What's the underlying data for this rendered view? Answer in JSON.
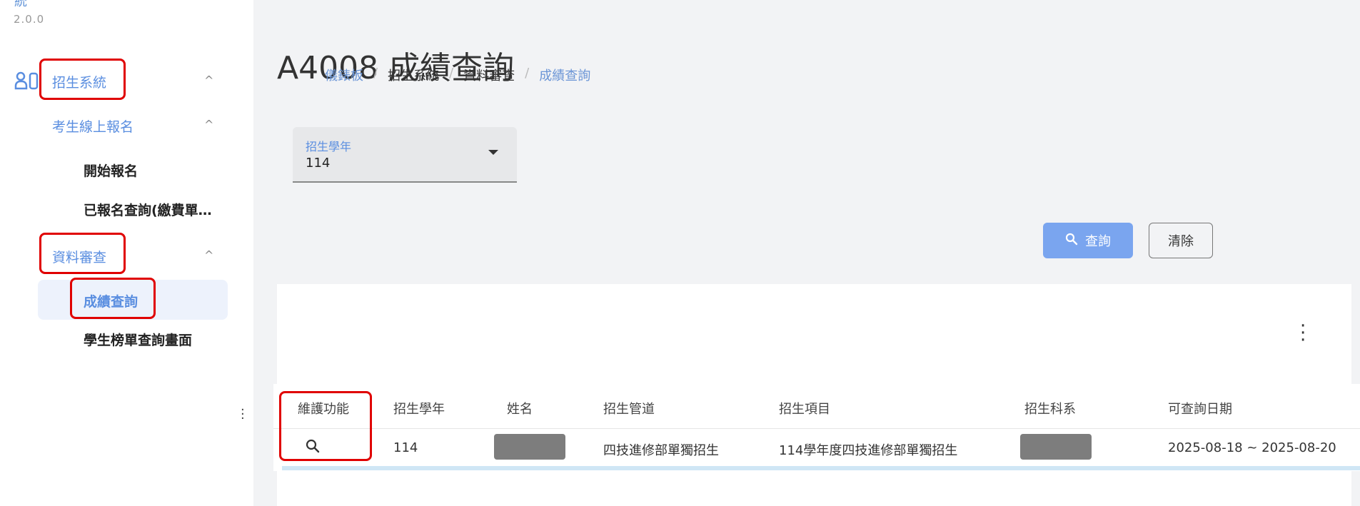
{
  "sidebar": {
    "title_fragment": "統",
    "version": "2.0.0",
    "items": [
      {
        "label": "招生系統",
        "level": 1,
        "expanded": true
      },
      {
        "label": "考生線上報名",
        "level": 2,
        "expanded": true
      },
      {
        "label": "開始報名",
        "level": 3
      },
      {
        "label": "已報名查詢(繳費單…",
        "level": 3
      },
      {
        "label": "資料審查",
        "level": 2,
        "expanded": true
      },
      {
        "label": "成績查詢",
        "level": 3,
        "selected": true
      },
      {
        "label": "學生榜單查詢畫面",
        "level": 3
      }
    ],
    "chevron": "^"
  },
  "page": {
    "title": "A4008 成績查詢",
    "breadcrumb": [
      "儀錶板",
      "招生系統",
      "資料審查",
      "成績查詢"
    ]
  },
  "filters": {
    "year": {
      "label": "招生學年",
      "value": "114"
    }
  },
  "buttons": {
    "query": "查詢",
    "clear": "清除"
  },
  "table": {
    "columns": [
      "維護功能",
      "招生學年",
      "姓名",
      "招生管道",
      "招生項目",
      "招生科系",
      "可查詢日期"
    ],
    "rows": [
      {
        "year": "114",
        "name": "",
        "channel": "四技進修部單獨招生",
        "item": "114學年度四技進修部單獨招生",
        "dept": "",
        "date_range": "2025-08-18 ~ 2025-08-20"
      }
    ]
  },
  "colors": {
    "accent": "#5a8ee0",
    "button_primary": "#7aa5ef",
    "highlight_box": "#e00000"
  }
}
